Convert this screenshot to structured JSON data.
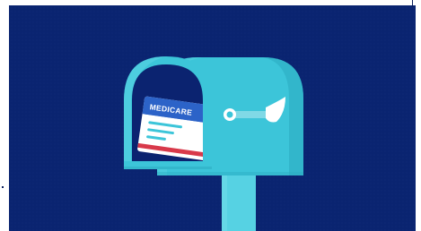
{
  "illustration": {
    "subject": "mailbox-with-medicare-card",
    "card": {
      "title": "MEDICARE"
    },
    "colors": {
      "background": "#0a2471",
      "mailbox": "#3cc5d9",
      "mailbox_shadow": "#2aa9c0",
      "mailbox_highlight": "#62d6e6",
      "mailbox_interior": "#0b2370",
      "post": "#56d2e3",
      "flag": "#ffffff",
      "card_header": "#2c63c8",
      "card_body": "#ffffff",
      "card_lines": "#3cc5d9",
      "card_stripe": "#d8394a"
    }
  }
}
